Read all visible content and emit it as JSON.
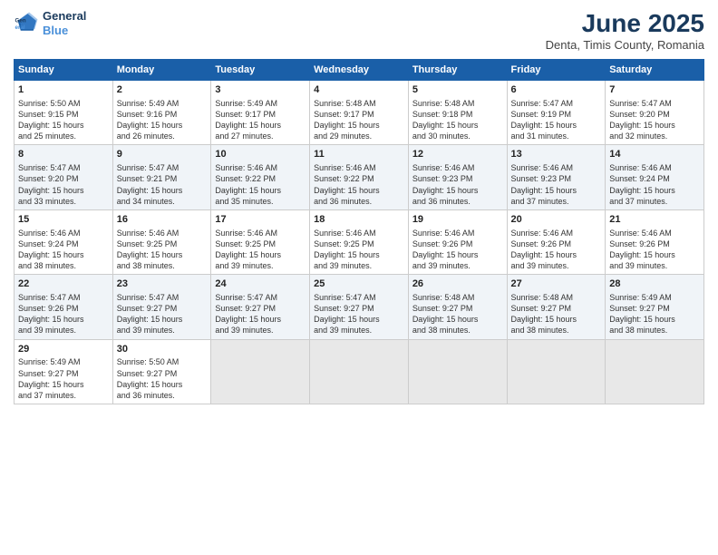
{
  "header": {
    "logo_line1": "General",
    "logo_line2": "Blue",
    "main_title": "June 2025",
    "subtitle": "Denta, Timis County, Romania"
  },
  "days_of_week": [
    "Sunday",
    "Monday",
    "Tuesday",
    "Wednesday",
    "Thursday",
    "Friday",
    "Saturday"
  ],
  "weeks": [
    [
      {
        "day": "1",
        "lines": [
          "Sunrise: 5:50 AM",
          "Sunset: 9:15 PM",
          "Daylight: 15 hours",
          "and 25 minutes."
        ]
      },
      {
        "day": "2",
        "lines": [
          "Sunrise: 5:49 AM",
          "Sunset: 9:16 PM",
          "Daylight: 15 hours",
          "and 26 minutes."
        ]
      },
      {
        "day": "3",
        "lines": [
          "Sunrise: 5:49 AM",
          "Sunset: 9:17 PM",
          "Daylight: 15 hours",
          "and 27 minutes."
        ]
      },
      {
        "day": "4",
        "lines": [
          "Sunrise: 5:48 AM",
          "Sunset: 9:17 PM",
          "Daylight: 15 hours",
          "and 29 minutes."
        ]
      },
      {
        "day": "5",
        "lines": [
          "Sunrise: 5:48 AM",
          "Sunset: 9:18 PM",
          "Daylight: 15 hours",
          "and 30 minutes."
        ]
      },
      {
        "day": "6",
        "lines": [
          "Sunrise: 5:47 AM",
          "Sunset: 9:19 PM",
          "Daylight: 15 hours",
          "and 31 minutes."
        ]
      },
      {
        "day": "7",
        "lines": [
          "Sunrise: 5:47 AM",
          "Sunset: 9:20 PM",
          "Daylight: 15 hours",
          "and 32 minutes."
        ]
      }
    ],
    [
      {
        "day": "8",
        "lines": [
          "Sunrise: 5:47 AM",
          "Sunset: 9:20 PM",
          "Daylight: 15 hours",
          "and 33 minutes."
        ]
      },
      {
        "day": "9",
        "lines": [
          "Sunrise: 5:47 AM",
          "Sunset: 9:21 PM",
          "Daylight: 15 hours",
          "and 34 minutes."
        ]
      },
      {
        "day": "10",
        "lines": [
          "Sunrise: 5:46 AM",
          "Sunset: 9:22 PM",
          "Daylight: 15 hours",
          "and 35 minutes."
        ]
      },
      {
        "day": "11",
        "lines": [
          "Sunrise: 5:46 AM",
          "Sunset: 9:22 PM",
          "Daylight: 15 hours",
          "and 36 minutes."
        ]
      },
      {
        "day": "12",
        "lines": [
          "Sunrise: 5:46 AM",
          "Sunset: 9:23 PM",
          "Daylight: 15 hours",
          "and 36 minutes."
        ]
      },
      {
        "day": "13",
        "lines": [
          "Sunrise: 5:46 AM",
          "Sunset: 9:23 PM",
          "Daylight: 15 hours",
          "and 37 minutes."
        ]
      },
      {
        "day": "14",
        "lines": [
          "Sunrise: 5:46 AM",
          "Sunset: 9:24 PM",
          "Daylight: 15 hours",
          "and 37 minutes."
        ]
      }
    ],
    [
      {
        "day": "15",
        "lines": [
          "Sunrise: 5:46 AM",
          "Sunset: 9:24 PM",
          "Daylight: 15 hours",
          "and 38 minutes."
        ]
      },
      {
        "day": "16",
        "lines": [
          "Sunrise: 5:46 AM",
          "Sunset: 9:25 PM",
          "Daylight: 15 hours",
          "and 38 minutes."
        ]
      },
      {
        "day": "17",
        "lines": [
          "Sunrise: 5:46 AM",
          "Sunset: 9:25 PM",
          "Daylight: 15 hours",
          "and 39 minutes."
        ]
      },
      {
        "day": "18",
        "lines": [
          "Sunrise: 5:46 AM",
          "Sunset: 9:25 PM",
          "Daylight: 15 hours",
          "and 39 minutes."
        ]
      },
      {
        "day": "19",
        "lines": [
          "Sunrise: 5:46 AM",
          "Sunset: 9:26 PM",
          "Daylight: 15 hours",
          "and 39 minutes."
        ]
      },
      {
        "day": "20",
        "lines": [
          "Sunrise: 5:46 AM",
          "Sunset: 9:26 PM",
          "Daylight: 15 hours",
          "and 39 minutes."
        ]
      },
      {
        "day": "21",
        "lines": [
          "Sunrise: 5:46 AM",
          "Sunset: 9:26 PM",
          "Daylight: 15 hours",
          "and 39 minutes."
        ]
      }
    ],
    [
      {
        "day": "22",
        "lines": [
          "Sunrise: 5:47 AM",
          "Sunset: 9:26 PM",
          "Daylight: 15 hours",
          "and 39 minutes."
        ]
      },
      {
        "day": "23",
        "lines": [
          "Sunrise: 5:47 AM",
          "Sunset: 9:27 PM",
          "Daylight: 15 hours",
          "and 39 minutes."
        ]
      },
      {
        "day": "24",
        "lines": [
          "Sunrise: 5:47 AM",
          "Sunset: 9:27 PM",
          "Daylight: 15 hours",
          "and 39 minutes."
        ]
      },
      {
        "day": "25",
        "lines": [
          "Sunrise: 5:47 AM",
          "Sunset: 9:27 PM",
          "Daylight: 15 hours",
          "and 39 minutes."
        ]
      },
      {
        "day": "26",
        "lines": [
          "Sunrise: 5:48 AM",
          "Sunset: 9:27 PM",
          "Daylight: 15 hours",
          "and 38 minutes."
        ]
      },
      {
        "day": "27",
        "lines": [
          "Sunrise: 5:48 AM",
          "Sunset: 9:27 PM",
          "Daylight: 15 hours",
          "and 38 minutes."
        ]
      },
      {
        "day": "28",
        "lines": [
          "Sunrise: 5:49 AM",
          "Sunset: 9:27 PM",
          "Daylight: 15 hours",
          "and 38 minutes."
        ]
      }
    ],
    [
      {
        "day": "29",
        "lines": [
          "Sunrise: 5:49 AM",
          "Sunset: 9:27 PM",
          "Daylight: 15 hours",
          "and 37 minutes."
        ]
      },
      {
        "day": "30",
        "lines": [
          "Sunrise: 5:50 AM",
          "Sunset: 9:27 PM",
          "Daylight: 15 hours",
          "and 36 minutes."
        ]
      },
      {
        "day": "",
        "lines": []
      },
      {
        "day": "",
        "lines": []
      },
      {
        "day": "",
        "lines": []
      },
      {
        "day": "",
        "lines": []
      },
      {
        "day": "",
        "lines": []
      }
    ]
  ]
}
